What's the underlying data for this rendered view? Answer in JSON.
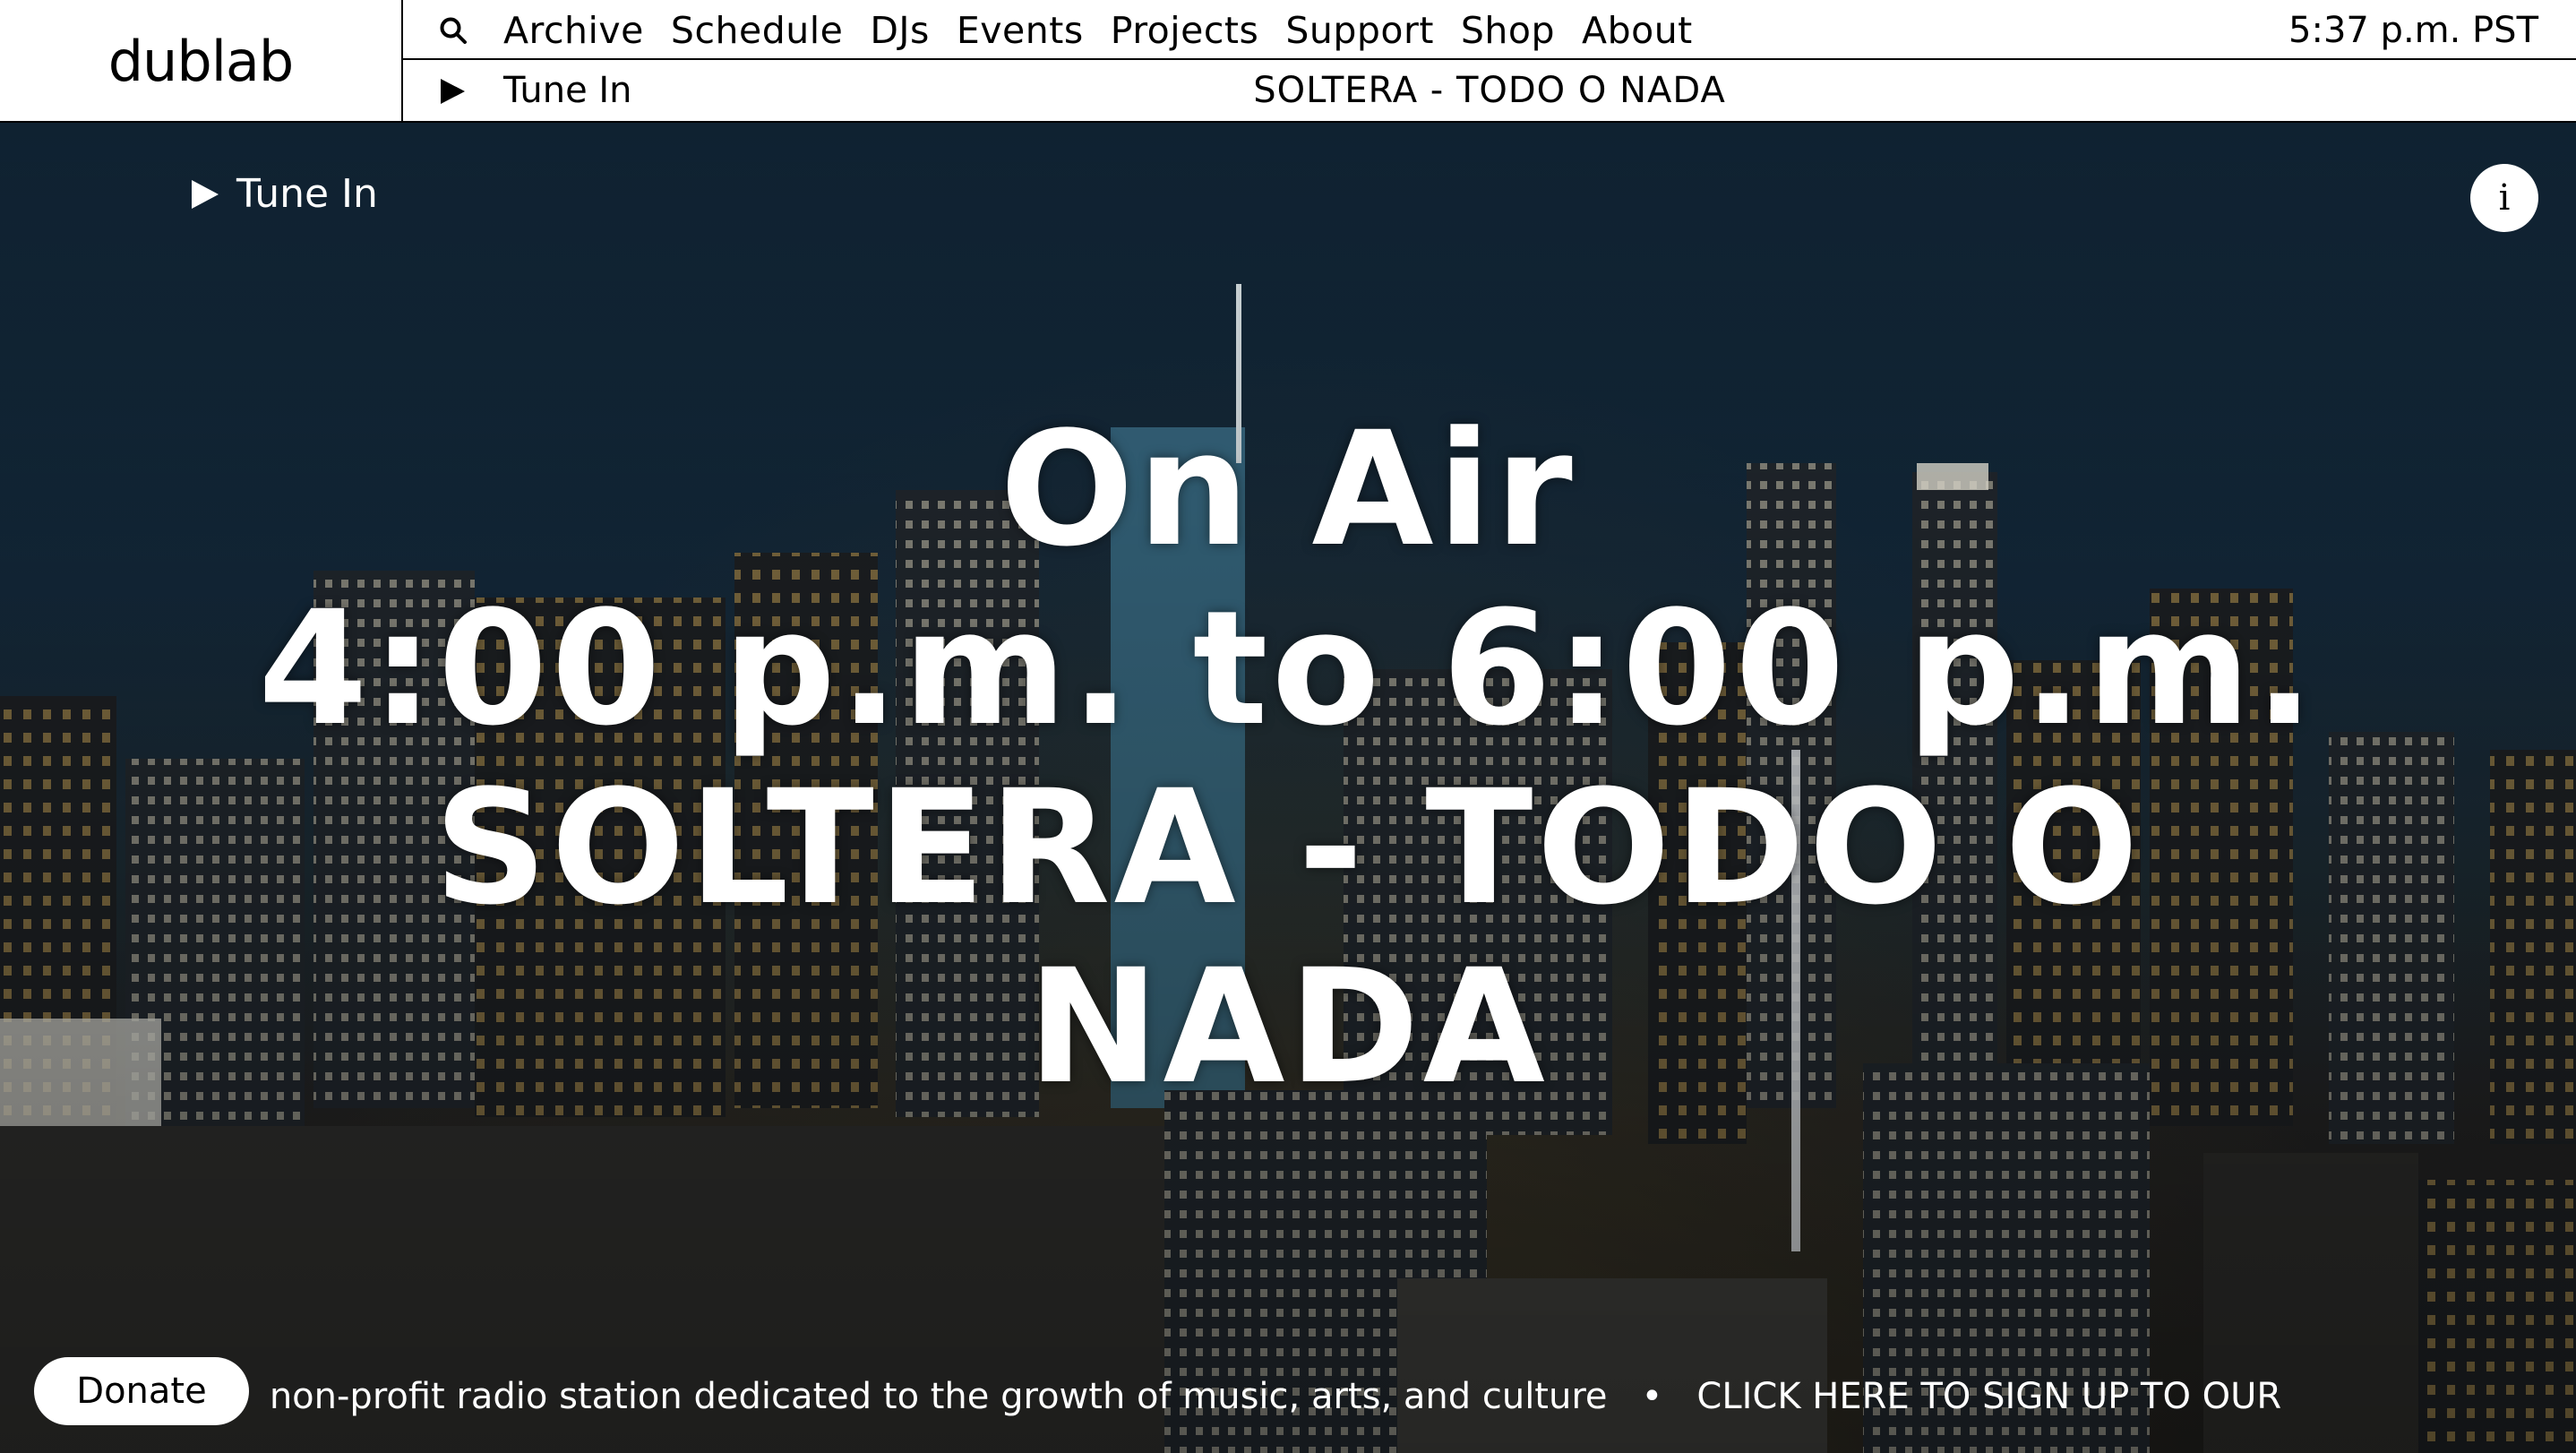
{
  "header": {
    "logo": "dublab",
    "nav": [
      "Archive",
      "Schedule",
      "DJs",
      "Events",
      "Projects",
      "Support",
      "Shop",
      "About"
    ],
    "clock": "5:37 p.m. PST",
    "player": {
      "tune_in_label": "Tune In",
      "now_playing": "SOLTERA - TODO O NADA"
    }
  },
  "hero": {
    "tune_in_label": "Tune In",
    "info_label": "i",
    "on_air_label": "On Air",
    "time_range": "4:00 p.m. to 6:00 p.m.",
    "show_title": "SOLTERA - TODO O NADA",
    "background": "night city skyline"
  },
  "footer": {
    "donate_label": "Donate",
    "ticker_text": "d, non-profit radio station dedicated to the growth of music, arts, and culture",
    "ticker_separator": "•",
    "ticker_cta": "CLICK HERE TO SIGN UP TO OUR"
  },
  "colors": {
    "header_bg": "#ffffff",
    "text_dark": "#000000",
    "hero_text": "#ffffff"
  }
}
